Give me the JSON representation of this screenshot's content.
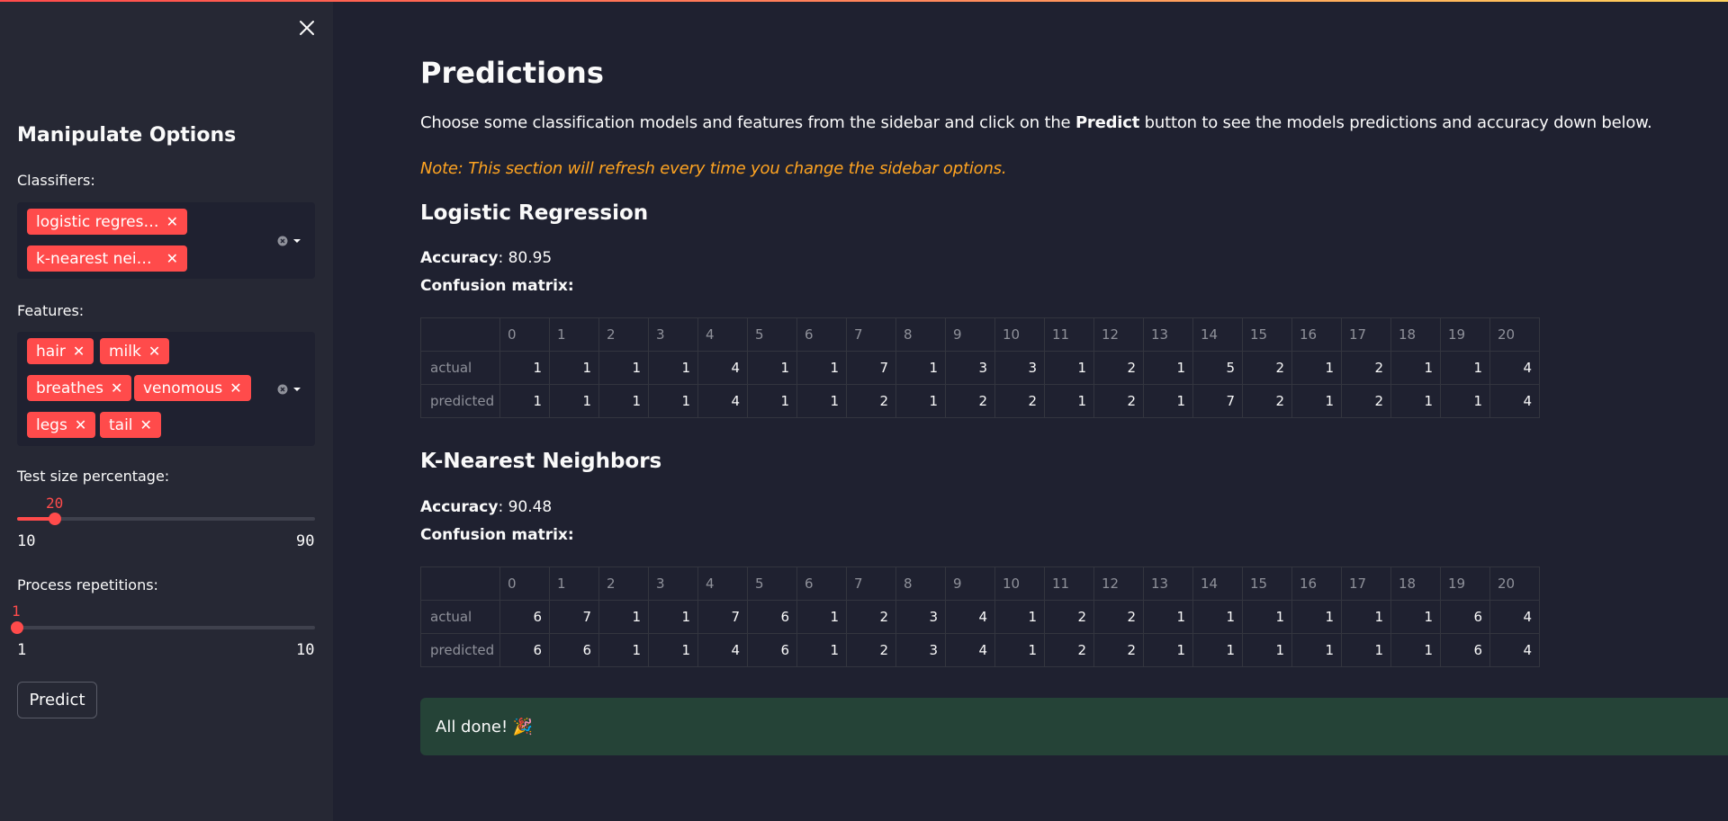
{
  "sidebar": {
    "title": "Manipulate Options",
    "classifiers": {
      "label": "Classifiers:",
      "selected": [
        "logistic regress…",
        "k-nearest neig…"
      ]
    },
    "features": {
      "label": "Features:",
      "selected": [
        "hair",
        "milk",
        "breathes",
        "venomous",
        "legs",
        "tail"
      ]
    },
    "test_size": {
      "label": "Test size percentage:",
      "value": "20",
      "min": "10",
      "max": "90"
    },
    "repetitions": {
      "label": "Process repetitions:",
      "value": "1",
      "min": "1",
      "max": "10"
    },
    "predict_label": "Predict"
  },
  "main": {
    "title": "Predictions",
    "intro_before": "Choose some classification models and features from the sidebar and click on the ",
    "intro_bold": "Predict",
    "intro_after": " button to see the models predictions and accuracy down below.",
    "note": "Note: This section will refresh every time you change the sidebar options.",
    "models": [
      {
        "name": "Logistic Regression",
        "accuracy_label": "Accuracy",
        "accuracy": ": 80.95",
        "cm_label": "Confusion matrix:",
        "columns": [
          "0",
          "1",
          "2",
          "3",
          "4",
          "5",
          "6",
          "7",
          "8",
          "9",
          "10",
          "11",
          "12",
          "13",
          "14",
          "15",
          "16",
          "17",
          "18",
          "19",
          "20"
        ],
        "rows": [
          {
            "label": "actual",
            "values": [
              "1",
              "1",
              "1",
              "1",
              "4",
              "1",
              "1",
              "7",
              "1",
              "3",
              "3",
              "1",
              "2",
              "1",
              "5",
              "2",
              "1",
              "2",
              "1",
              "1",
              "4"
            ]
          },
          {
            "label": "predicted",
            "values": [
              "1",
              "1",
              "1",
              "1",
              "4",
              "1",
              "1",
              "2",
              "1",
              "2",
              "2",
              "1",
              "2",
              "1",
              "7",
              "2",
              "1",
              "2",
              "1",
              "1",
              "4"
            ]
          }
        ]
      },
      {
        "name": "K-Nearest Neighbors",
        "accuracy_label": "Accuracy",
        "accuracy": ": 90.48",
        "cm_label": "Confusion matrix:",
        "columns": [
          "0",
          "1",
          "2",
          "3",
          "4",
          "5",
          "6",
          "7",
          "8",
          "9",
          "10",
          "11",
          "12",
          "13",
          "14",
          "15",
          "16",
          "17",
          "18",
          "19",
          "20"
        ],
        "rows": [
          {
            "label": "actual",
            "values": [
              "6",
              "7",
              "1",
              "1",
              "7",
              "6",
              "1",
              "2",
              "3",
              "4",
              "1",
              "2",
              "2",
              "1",
              "1",
              "1",
              "1",
              "1",
              "1",
              "6",
              "4"
            ]
          },
          {
            "label": "predicted",
            "values": [
              "6",
              "6",
              "1",
              "1",
              "4",
              "6",
              "1",
              "2",
              "3",
              "4",
              "1",
              "2",
              "2",
              "1",
              "1",
              "1",
              "1",
              "1",
              "1",
              "6",
              "4"
            ]
          }
        ]
      }
    ],
    "success_message": "All done! 🎉"
  }
}
